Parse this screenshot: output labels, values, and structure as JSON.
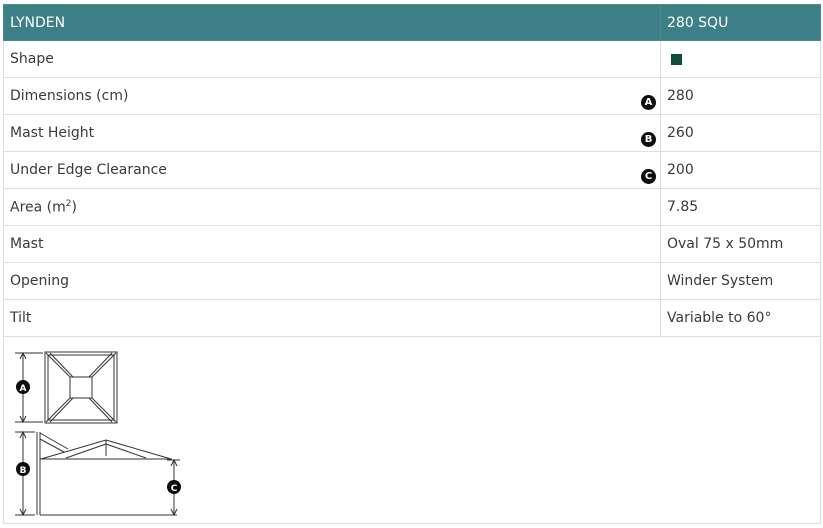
{
  "header": {
    "name": "LYNDEN",
    "model": "280 SQU"
  },
  "rows": [
    {
      "label": "Shape",
      "value": "",
      "swatch_color": "#0f4d3b"
    },
    {
      "label": "Dimensions (cm)",
      "value": "280",
      "marker": "A"
    },
    {
      "label": "Mast Height",
      "value": "260",
      "marker": "B"
    },
    {
      "label": "Under Edge Clearance",
      "value": "200",
      "marker": "C"
    },
    {
      "label_base": "Area (m",
      "label_sup": "2",
      "label_end": ")",
      "value": "7.85"
    },
    {
      "label": "Mast",
      "value": "Oval 75 x 50mm"
    },
    {
      "label": "Opening",
      "value": "Winder System"
    },
    {
      "label": "Tilt",
      "value": "Variable to 60°"
    }
  ],
  "diagram": {
    "markers": [
      "A",
      "B",
      "C"
    ]
  }
}
